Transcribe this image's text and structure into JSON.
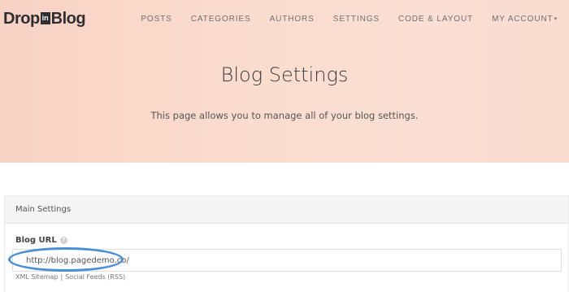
{
  "brand": {
    "part1": "Drop",
    "part2": "in",
    "part3": "Blog"
  },
  "nav": {
    "items": [
      "POSTS",
      "CATEGORIES",
      "AUTHORS",
      "SETTINGS",
      "CODE & LAYOUT",
      "MY ACCOUNT"
    ],
    "account_caret": "▾"
  },
  "hero": {
    "title": "Blog Settings",
    "subtitle": "This page allows you to manage all of your blog settings."
  },
  "main_settings": {
    "heading": "Main Settings",
    "blog_url_label": "Blog URL",
    "help_icon_glyph": "?",
    "blog_url_value": "http://blog.pagedemo.co/",
    "links": {
      "xml_sitemap": "XML Sitemap",
      "separator": "|",
      "social_feeds": "Social Feeds (RSS)"
    }
  },
  "colors": {
    "highlight": "#4a8fd6",
    "hero_start": "#f8d2c4",
    "hero_end": "#fadbd0"
  }
}
